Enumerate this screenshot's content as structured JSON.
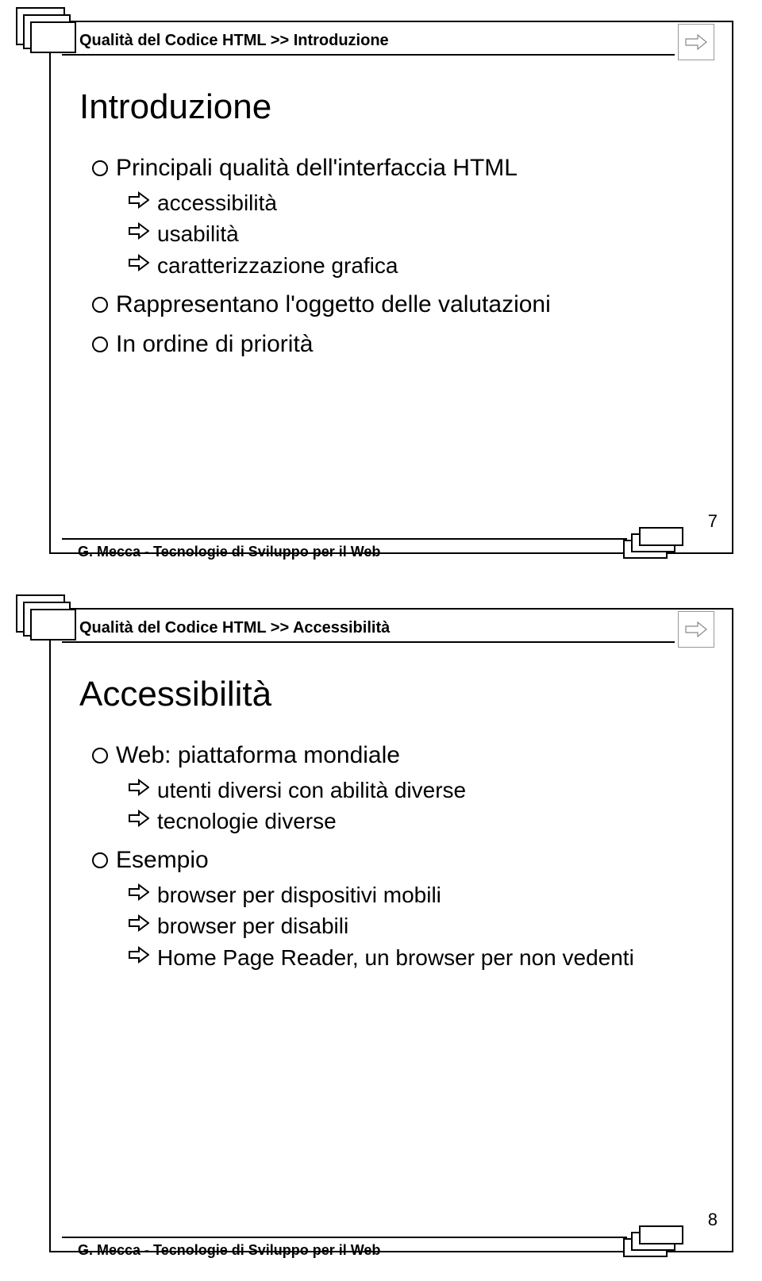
{
  "slide1": {
    "breadcrumb": "Qualità del Codice HTML >> Introduzione",
    "title": "Introduzione",
    "items": [
      {
        "level": 1,
        "text": "Principali qualità dell'interfaccia HTML"
      },
      {
        "level": 2,
        "text": "accessibilità"
      },
      {
        "level": 2,
        "text": "usabilità"
      },
      {
        "level": 2,
        "text": "caratterizzazione grafica"
      },
      {
        "level": 1,
        "text": "Rappresentano l'oggetto delle valutazioni"
      },
      {
        "level": 1,
        "text": "In ordine di priorità"
      }
    ],
    "footer": "G. Mecca - Tecnologie di Sviluppo per il Web",
    "page": "7"
  },
  "slide2": {
    "breadcrumb": "Qualità del Codice HTML >> Accessibilità",
    "title": "Accessibilità",
    "items": [
      {
        "level": 1,
        "text": "Web: piattaforma mondiale"
      },
      {
        "level": 2,
        "text": "utenti diversi con abilità diverse"
      },
      {
        "level": 2,
        "text": "tecnologie diverse"
      },
      {
        "level": 1,
        "text": "Esempio"
      },
      {
        "level": 2,
        "text": "browser per dispositivi mobili"
      },
      {
        "level": 2,
        "text": "browser per disabili"
      },
      {
        "level": 2,
        "text": "Home Page Reader, un browser per non vedenti"
      }
    ],
    "footer": "G. Mecca - Tecnologie di Sviluppo per il Web",
    "page": "8"
  }
}
